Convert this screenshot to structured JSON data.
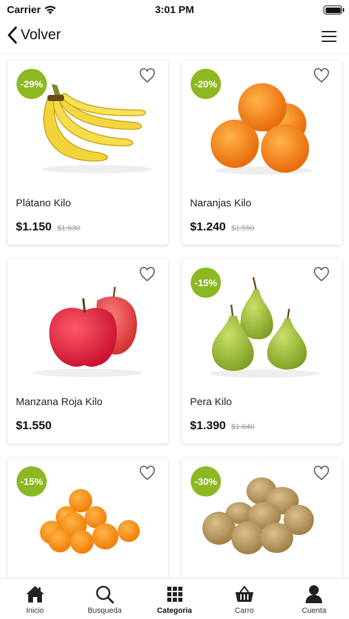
{
  "status_bar": {
    "carrier": "Carrier",
    "time": "3:01 PM"
  },
  "nav": {
    "back_label": "Volver"
  },
  "products": [
    {
      "name": "Plátano Kilo",
      "price": "$1.150",
      "old_price": "$1.630",
      "discount": "-29%",
      "image": "banana"
    },
    {
      "name": "Naranjas Kilo",
      "price": "$1.240",
      "old_price": "$1.550",
      "discount": "-20%",
      "image": "orange"
    },
    {
      "name": "Manzana Roja Kilo",
      "price": "$1.550",
      "old_price": "",
      "discount": "",
      "image": "apple"
    },
    {
      "name": "Pera Kilo",
      "price": "$1.390",
      "old_price": "$1.640",
      "discount": "-15%",
      "image": "pear"
    },
    {
      "name": "",
      "price": "",
      "old_price": "",
      "discount": "-15%",
      "image": "mandarin"
    },
    {
      "name": "",
      "price": "",
      "old_price": "",
      "discount": "-30%",
      "image": "kiwi"
    }
  ],
  "tabs": [
    {
      "label": "Inicio",
      "icon": "home-icon"
    },
    {
      "label": "Busqueda",
      "icon": "search-icon"
    },
    {
      "label": "Categoria",
      "icon": "grid-icon",
      "active": true
    },
    {
      "label": "Carro",
      "icon": "basket-icon"
    },
    {
      "label": "Cuenta",
      "icon": "user-icon"
    }
  ],
  "colors": {
    "discount_badge": "#8cb923"
  }
}
